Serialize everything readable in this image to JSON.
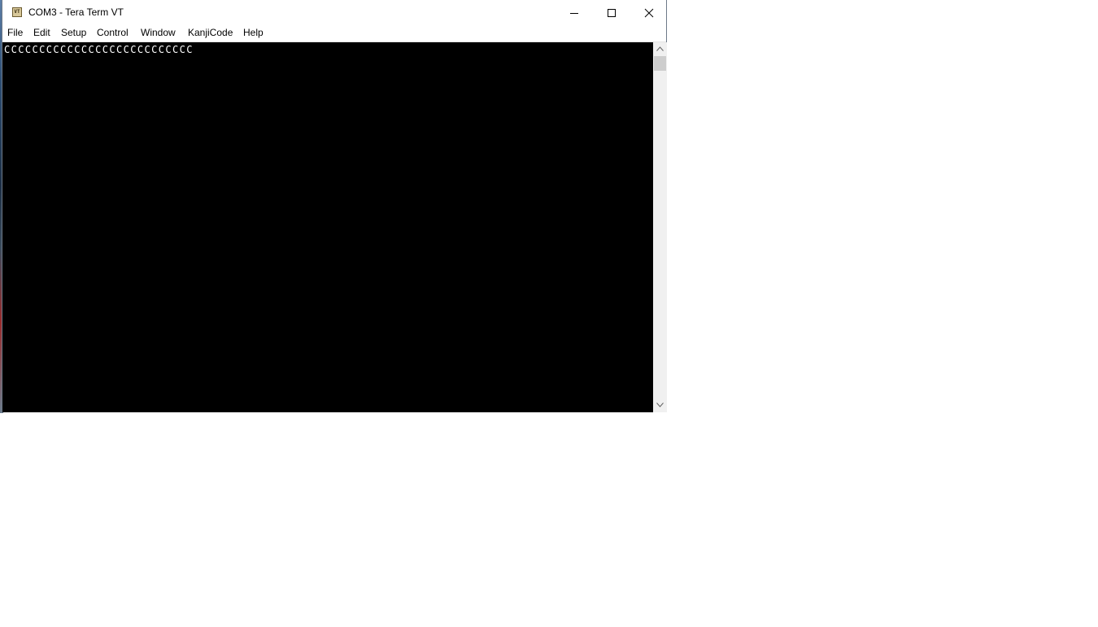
{
  "window": {
    "title": "COM3 - Tera Term VT",
    "icon": "vt-terminal-icon",
    "icon_text": "VT"
  },
  "caption_buttons": {
    "minimize": "minimize-icon",
    "maximize": "maximize-icon",
    "close": "close-icon"
  },
  "menu": {
    "items": [
      {
        "label": "File"
      },
      {
        "label": "Edit"
      },
      {
        "label": "Setup"
      },
      {
        "label": "Control"
      },
      {
        "label": "Window"
      },
      {
        "label": "KanjiCode"
      },
      {
        "label": "Help"
      }
    ]
  },
  "terminal": {
    "lines": [
      "CCCCCCCCCCCCCCCCCCCCCCCCCCC"
    ],
    "background": "#000000",
    "foreground": "#ffffff"
  },
  "scrollbar": {
    "up": "chevron-up-icon",
    "down": "chevron-down-icon"
  }
}
